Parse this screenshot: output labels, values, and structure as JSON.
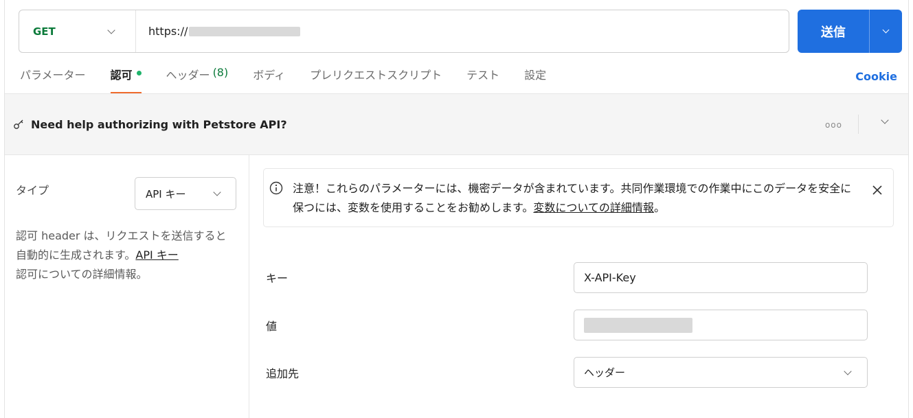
{
  "request": {
    "method": "GET",
    "url_prefix": "https://",
    "send_label": "送信"
  },
  "tabs": [
    {
      "label": "パラメーター"
    },
    {
      "label": "認可"
    },
    {
      "label": "ヘッダー",
      "count": "(8)"
    },
    {
      "label": "ボディ"
    },
    {
      "label": "プレリクエストスクリプト"
    },
    {
      "label": "テスト"
    },
    {
      "label": "設定"
    }
  ],
  "cookie_label": "Cookie",
  "banner": {
    "text": "Need help authorizing with Petstore API?",
    "more": "ooo"
  },
  "auth": {
    "type_label": "タイプ",
    "type_value": "API キー",
    "desc_prefix": "認可 header は、リクエストを送信すると自動的に生成されます。",
    "desc_link": "API キー",
    "desc_suffix": "認可についての詳細情報。"
  },
  "notice": {
    "text": "注意！これらのパラメーターには、機密データが含まれています。共同作業環境での作業中にこのデータを安全に保つには、変数を使用することをお勧めします。",
    "link": "変数についての詳細情報",
    "suffix": "。"
  },
  "form": {
    "key_label": "キー",
    "key_value": "X-API-Key",
    "value_label": "値",
    "add_to_label": "追加先",
    "add_to_value": "ヘッダー"
  },
  "colors": {
    "accent": "#1f6fe0",
    "method_get": "#0b7a3a",
    "active_tab_underline": "#ef6b2c",
    "status_dot": "#1fb36b"
  }
}
